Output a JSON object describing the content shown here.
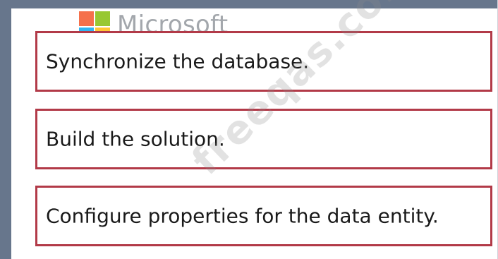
{
  "logo": {
    "icon": "microsoft-logo-icon",
    "text": "Microsoft",
    "colors": {
      "red": "#f35325",
      "green": "#81bc06",
      "blue": "#05a6f0",
      "yellow": "#ffba08",
      "wordmark": "#8f949a"
    }
  },
  "steps": [
    {
      "label": "Synchronize the database."
    },
    {
      "label": "Build the solution."
    },
    {
      "label": "Configure properties for the data entity."
    }
  ],
  "watermark": {
    "text": "freeqas.com"
  },
  "colors": {
    "box_border": "#b23a48",
    "frame_edge": "#67768c"
  }
}
